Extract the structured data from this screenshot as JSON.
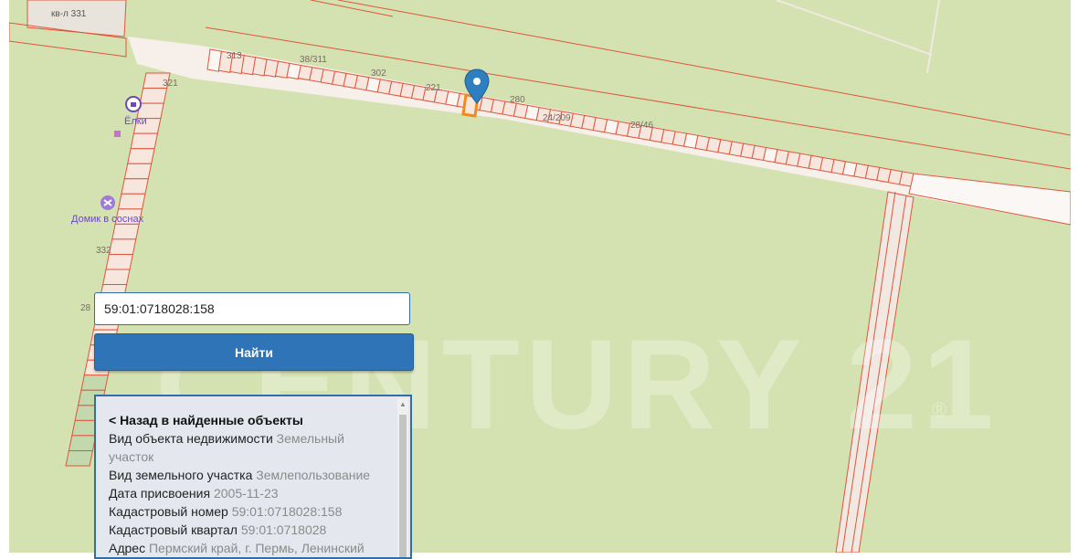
{
  "map": {
    "block_label": "кв-л 331",
    "plot_labels": [
      "313",
      "38/311",
      "302",
      "321",
      "221",
      "280",
      "24/209",
      "28/46",
      "332",
      "28"
    ],
    "poi": [
      {
        "name": "Ёлки",
        "icon": "shop-icon"
      },
      {
        "name": "Домик в соснах",
        "icon": "attraction-icon"
      }
    ],
    "marker_icon": "map-pin-icon",
    "watermark": "CENTURY 21",
    "watermark_mark": "®"
  },
  "search": {
    "value": "59:01:0718028:158",
    "button_label": "Найти"
  },
  "details": {
    "back_label": "< Назад в найденные объекты",
    "rows": [
      {
        "label": "Вид объекта недвижимости",
        "value": "Земельный участок"
      },
      {
        "label": "Вид земельного участка",
        "value": "Землепользование"
      },
      {
        "label": "Дата присвоения",
        "value": "2005-11-23"
      },
      {
        "label": "Кадастровый номер",
        "value": "59:01:0718028:158"
      },
      {
        "label": "Кадастровый квартал",
        "value": "59:01:0718028"
      },
      {
        "label": "Адрес",
        "value": "Пермский край, г. Пермь, Ленинский"
      }
    ]
  },
  "colors": {
    "map_bg": "#d4e2b2",
    "parcel_line": "#e0553a",
    "parcel_fill": "#f6e6de",
    "selected_parcel": "#f08a1c",
    "accent": "#2e74b6",
    "marker": "#2e7fc0"
  }
}
